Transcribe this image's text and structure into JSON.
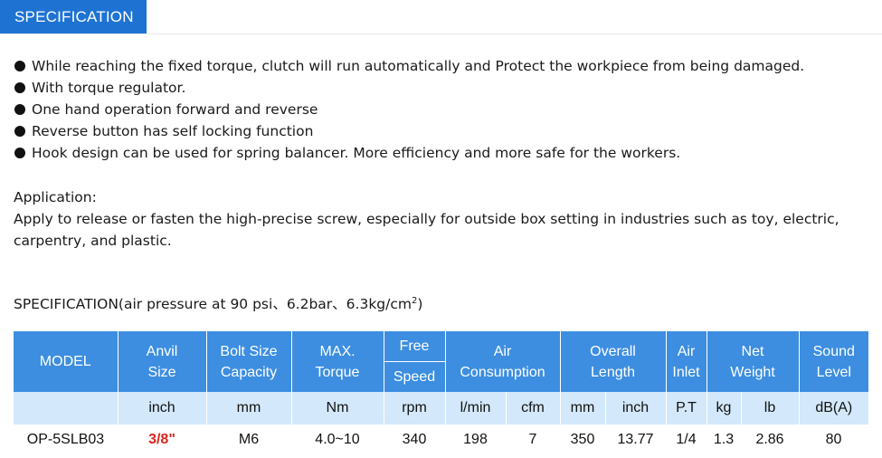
{
  "tab": {
    "label": "SPECIFICATION"
  },
  "features": [
    "While reaching the fixed torque, clutch will run automatically and Protect the workpiece from being damaged.",
    "With torque regulator.",
    "One hand operation forward and reverse",
    "Reverse button has self locking function",
    "Hook design can be used for spring balancer. More efficiency and more safe for the workers."
  ],
  "application": {
    "title": "Application:",
    "body": "Apply to release or fasten the high-precise screw, especially for outside box setting in industries such as toy, electric, carpentry, and plastic."
  },
  "spec_heading": {
    "text": "SPECIFICATION(air pressure at 90 psi、6.2bar、6.3kg/cm",
    "sup": "2",
    "close": ")"
  },
  "table": {
    "header": {
      "model": "MODEL",
      "anvil_1": "Anvil",
      "anvil_2": "Size",
      "bolt_1": "Bolt Size",
      "bolt_2": "Capacity",
      "torque_1": "MAX.",
      "torque_2": "Torque",
      "free_1": "Free",
      "free_2": "Speed",
      "air_1": "Air",
      "air_2": "Consumption",
      "length_1": "Overall",
      "length_2": "Length",
      "inlet_1": "Air",
      "inlet_2": "Inlet",
      "weight_1": "Net",
      "weight_2": "Weight",
      "sound_1": "Sound",
      "sound_2": "Level"
    },
    "units": [
      "inch",
      "mm",
      "Nm",
      "rpm",
      "l/min",
      "cfm",
      "mm",
      "inch",
      "P.T",
      "kg",
      "lb",
      "dB(A)"
    ],
    "rows": [
      {
        "model": "OP-5SLB03",
        "anvil": "3/8\"",
        "bolt": "M6",
        "torque": "4.0~10",
        "speed": "340",
        "lmin": "198",
        "cfm": "7",
        "mm": "350",
        "inch": "13.77",
        "inlet": "1/4",
        "kg": "1.3",
        "lb": "2.86",
        "dba": "80"
      }
    ]
  }
}
